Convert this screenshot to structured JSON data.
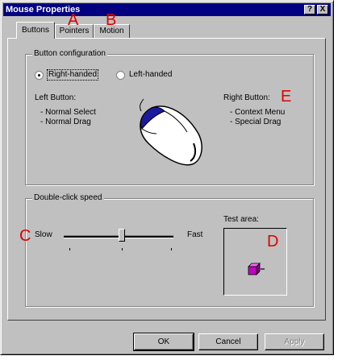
{
  "window": {
    "title": "Mouse Properties",
    "help_button": "?",
    "close_button": "X"
  },
  "tabs": [
    {
      "label": "Buttons",
      "active": true
    },
    {
      "label": "Pointers",
      "active": false
    },
    {
      "label": "Motion",
      "active": false
    }
  ],
  "button_configuration": {
    "group_label": "Button configuration",
    "right_handed": "Right-handed",
    "left_handed": "Left-handed",
    "selected": "Right-handed",
    "left_button": {
      "heading": "Left Button:",
      "items": [
        "- Normal Select",
        "- Normal Drag"
      ]
    },
    "right_button": {
      "heading": "Right Button:",
      "items": [
        "- Context Menu",
        "- Special Drag"
      ]
    }
  },
  "double_click": {
    "group_label": "Double-click speed",
    "slow_label": "Slow",
    "fast_label": "Fast",
    "speed_fraction": 0.5,
    "test_area_label": "Test area:"
  },
  "annotations": {
    "a": "A",
    "b": "B",
    "c": "C",
    "d": "D",
    "e": "E"
  },
  "buttons": {
    "ok": "OK",
    "cancel": "Cancel",
    "apply": "Apply"
  },
  "colors": {
    "title_bar": "#000080",
    "face": "#c0c0c0",
    "mouse_accent": "#1a1aa0",
    "jack_box": "#c000c0",
    "annotation": "#e00000"
  }
}
